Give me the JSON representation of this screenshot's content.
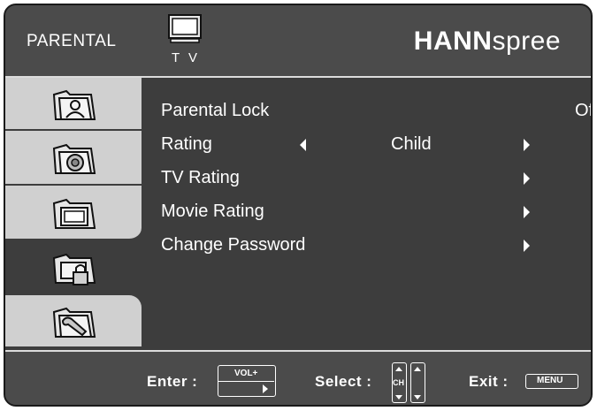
{
  "header": {
    "section": "PARENTAL",
    "source_label": "T V",
    "brand_bold": "HANN",
    "brand_light": "spree",
    "source_icon": "tv-icon"
  },
  "sidebar": {
    "tabs": [
      {
        "icon": "picture-icon",
        "active": false
      },
      {
        "icon": "sound-icon",
        "active": false
      },
      {
        "icon": "screen-icon",
        "active": false
      },
      {
        "icon": "parental-lock-icon",
        "active": true
      },
      {
        "icon": "setup-wrench-icon",
        "active": false
      }
    ]
  },
  "menu": {
    "parental_lock": {
      "label": "Parental Lock",
      "value": "Off"
    },
    "rating": {
      "label": "Rating",
      "value": "Child"
    },
    "tv_rating": {
      "label": "TV Rating"
    },
    "movie_rating": {
      "label": "Movie Rating"
    },
    "change_password": {
      "label": "Change Password"
    }
  },
  "footer": {
    "enter_label": "Enter :",
    "enter_key": "VOL+",
    "select_label": "Select :",
    "select_key": "CH",
    "exit_label": "Exit :",
    "exit_key": "MENU"
  },
  "colors": {
    "panel": "#3d3d3d",
    "header": "#4b4b4b",
    "tab_inactive": "#d0d0d0",
    "text": "#ffffff"
  }
}
